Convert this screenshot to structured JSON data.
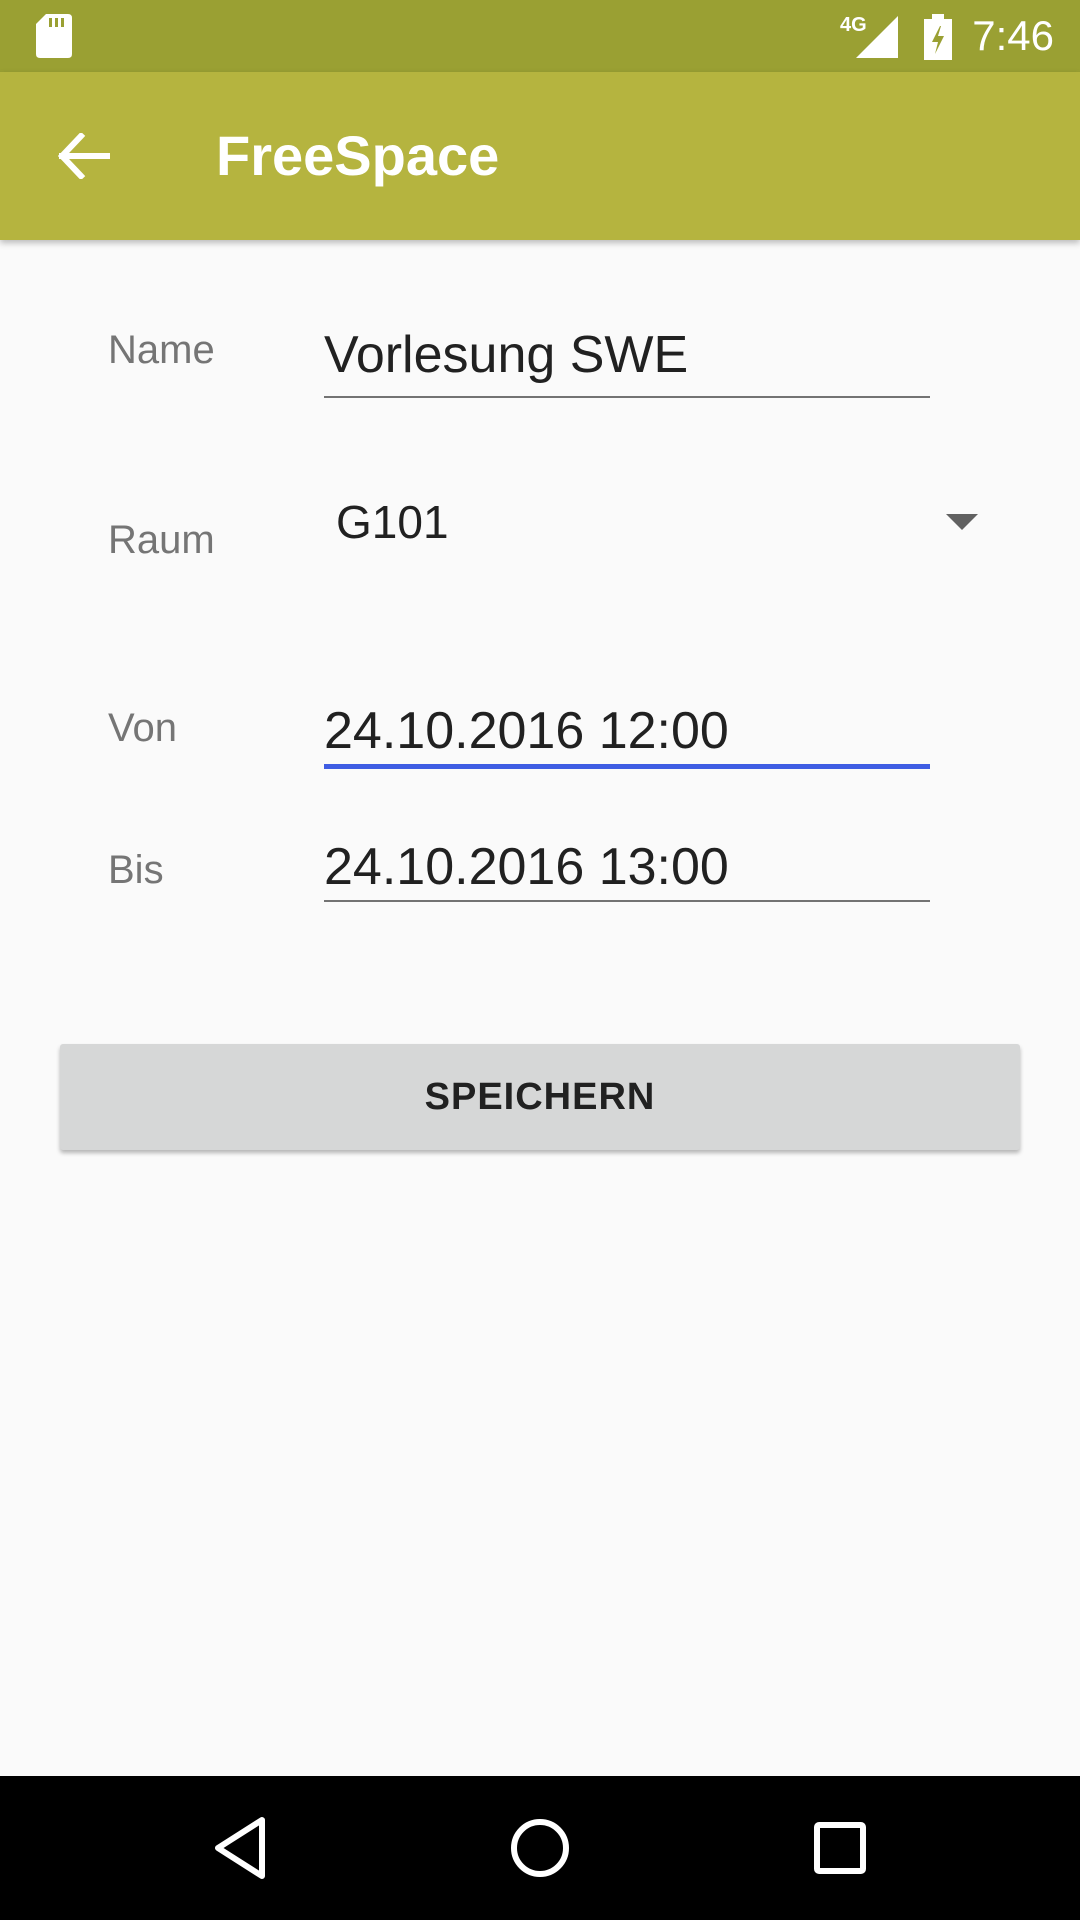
{
  "status_bar": {
    "network_label": "4G",
    "time": "7:46",
    "icons": [
      "sd-card-icon",
      "signal-icon",
      "battery-charging-icon"
    ]
  },
  "app_bar": {
    "title": "FreeSpace",
    "back_icon": "arrow-left-icon",
    "background": "#b5b43f"
  },
  "form": {
    "name": {
      "label": "Name",
      "value": "Vorlesung SWE"
    },
    "room": {
      "label": "Raum",
      "selected": "G101"
    },
    "from": {
      "label": "Von",
      "value": "24.10.2016 12:00"
    },
    "to": {
      "label": "Bis",
      "value": "24.10.2016 13:00"
    },
    "save_label": "SPEICHERN"
  },
  "colors": {
    "status_bar": "#9aa033",
    "focus_underline": "#3f5de3",
    "button": "#d6d7d7"
  },
  "nav_bar": {
    "icons": [
      "back-triangle-icon",
      "home-circle-icon",
      "recents-square-icon"
    ]
  }
}
